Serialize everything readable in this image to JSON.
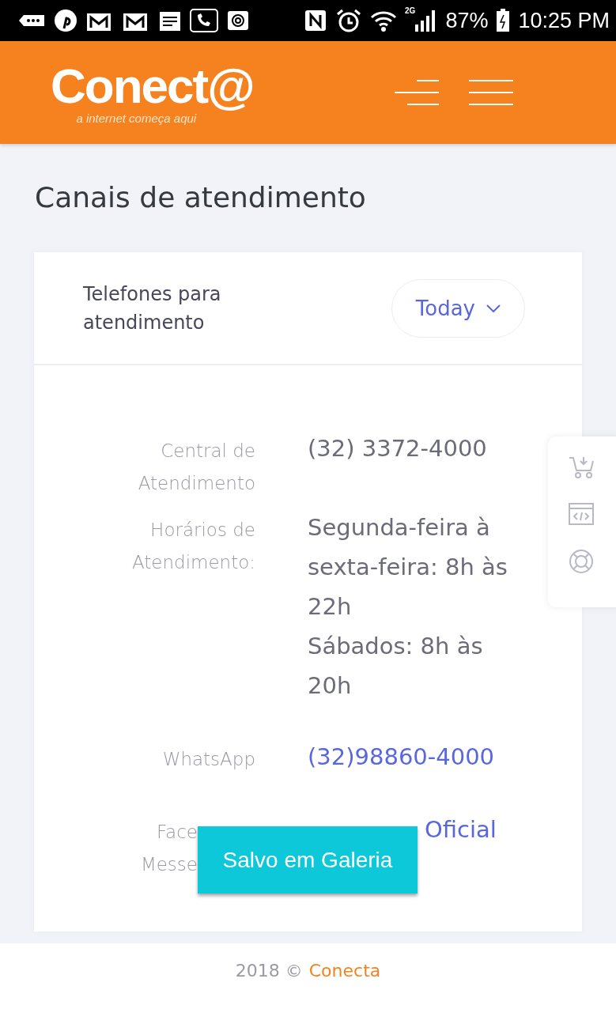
{
  "status_bar": {
    "network": "2G",
    "battery": "87%",
    "time": "10:25 PM"
  },
  "header": {
    "logo": "Conect@",
    "tagline": "a internet começa aqui"
  },
  "page_title": "Canais de atendimento",
  "card": {
    "title": "Telefones para atendimento",
    "dropdown": "Today",
    "rows": [
      {
        "kind": "text",
        "label": [
          "Central de Atendimento"
        ],
        "value": [
          "(32) 3372-4000"
        ]
      },
      {
        "kind": "text",
        "label": [
          "Horários de Atendimento:"
        ],
        "value": [
          "Segunda-feira à sexta-feira: 8h às 22h",
          "Sábados: 8h às 20h"
        ]
      },
      {
        "kind": "link",
        "label": [
          "WhatsApp"
        ],
        "value": [
          "(32)98860-4000"
        ]
      },
      {
        "kind": "covered-link",
        "label": [
          "Face",
          "Messe"
        ],
        "value": [
          "Oficial"
        ]
      }
    ]
  },
  "toast": "Salvo em Galeria",
  "footer": {
    "text": "2018 ©",
    "brand": "Conecta"
  }
}
